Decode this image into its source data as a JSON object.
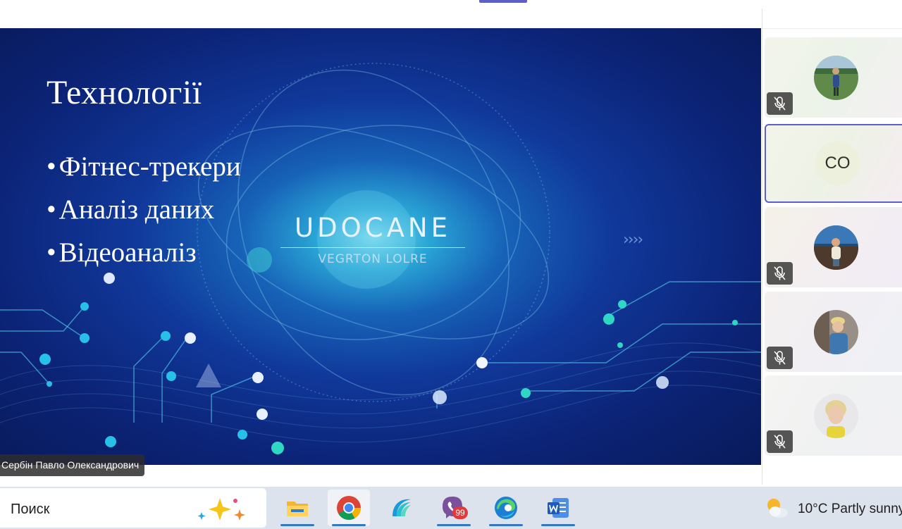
{
  "meeting": {
    "presenter_name": "Сербін Павло Олександрович"
  },
  "slide": {
    "title": "Технології",
    "bullets": [
      "Фітнес-трекери",
      "Аналіз даних",
      "Відеоаналіз"
    ],
    "logo_text": "UDOCANE",
    "logo_subtext": "VEGRTON LOLRE",
    "chevrons": "››››"
  },
  "participants": [
    {
      "avatar": "photo-person-on-field",
      "muted": true
    },
    {
      "initials": "CO",
      "active_speaker": true
    },
    {
      "avatar": "photo-person-by-sea",
      "muted": true
    },
    {
      "avatar": "photo-blond-boy",
      "muted": true
    },
    {
      "avatar": "photo-short-hair-person",
      "muted": true
    }
  ],
  "taskbar": {
    "search_label": "Поиск",
    "apps": [
      {
        "name": "file-explorer",
        "icon": "folder-icon"
      },
      {
        "name": "chrome",
        "icon": "chrome-icon"
      },
      {
        "name": "app-wave",
        "icon": "wave-app-icon"
      },
      {
        "name": "viber",
        "icon": "viber-icon",
        "badge": "99"
      },
      {
        "name": "edge",
        "icon": "edge-icon"
      },
      {
        "name": "word",
        "icon": "word-icon"
      }
    ],
    "weather": {
      "text": "10°C  Partly sunny",
      "icon": "partly-sunny-icon"
    }
  },
  "colors": {
    "accent": "#5b5fc7",
    "slide_bg": "#0c2478",
    "taskbar_bg": "#dde3ec",
    "badge": "#e03a3a"
  }
}
